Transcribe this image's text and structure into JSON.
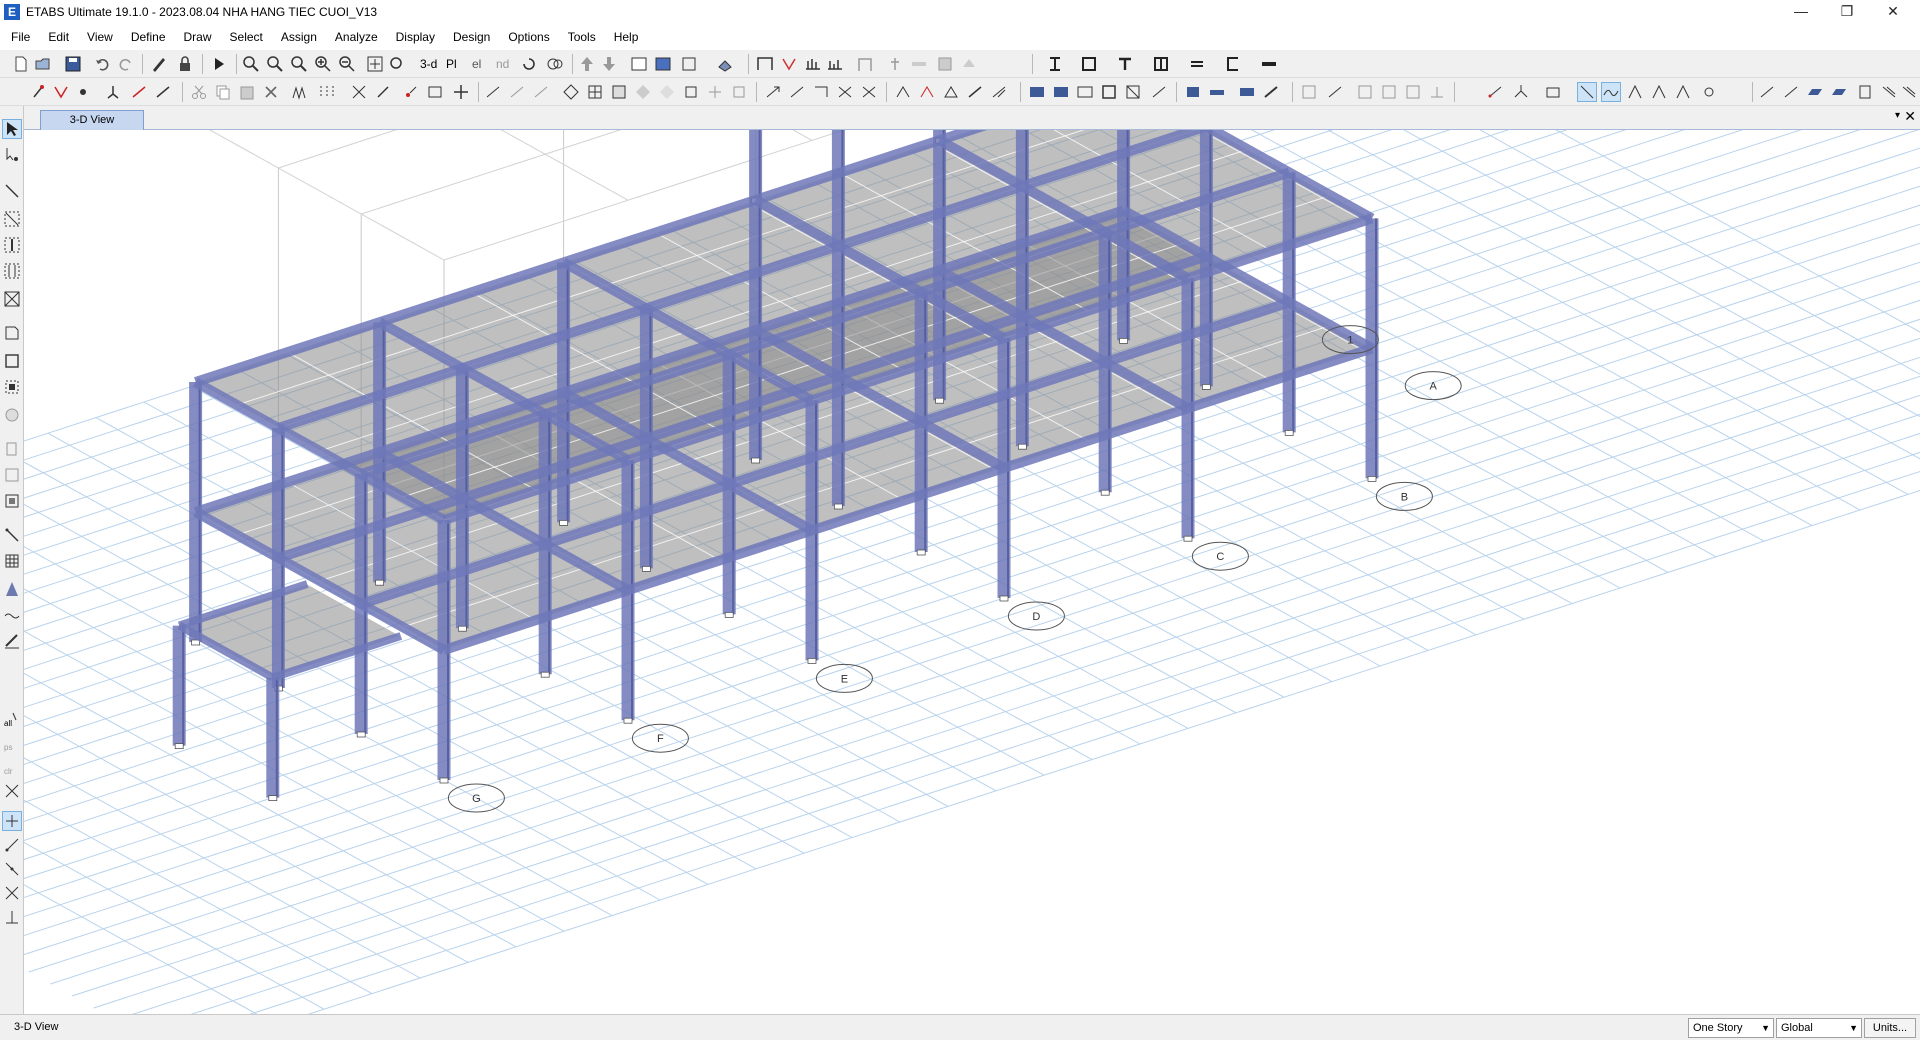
{
  "window": {
    "title": "ETABS Ultimate 19.1.0 - 2023.08.04 NHA HANG TIEC CUOI_V13",
    "app_icon_letter": "E",
    "minimize": "—",
    "restore": "❐",
    "close": "✕"
  },
  "menu": [
    "File",
    "Edit",
    "View",
    "Define",
    "Draw",
    "Select",
    "Assign",
    "Analyze",
    "Display",
    "Design",
    "Options",
    "Tools",
    "Help"
  ],
  "toolbar": {
    "view_3d_label": "3-d",
    "plan_label": "Pl",
    "elev_label": "el",
    "nd_label": "nd"
  },
  "tabs": {
    "active": "3-D View",
    "dropdown_glyph": "▾",
    "close_glyph": "✕"
  },
  "model_view": {
    "grid_bubbles": [
      "G",
      "F",
      "E",
      "D",
      "C",
      "B",
      "A",
      "1"
    ],
    "colors": {
      "frame": "#6f78b8",
      "frame_dark": "#4e5897",
      "slab": "#8a8a8a",
      "grid": "#b9d3ec",
      "background": "#ffffff"
    }
  },
  "statusbar": {
    "view_name": "3-D View",
    "story_combo": "One Story",
    "coord_combo": "Global",
    "units_button": "Units..."
  },
  "icons": {
    "left_toolbar": [
      "pointer-icon",
      "reshape-icon",
      "draw-frame-icon",
      "draw-beam-icon",
      "draw-column-icon",
      "draw-brace-icon",
      "draw-wall-icon",
      "draw-floor-icon",
      "draw-opening-icon",
      "draw-link-icon",
      "draw-grid-icon",
      "draw-section-cut-icon",
      "draw-dimension-icon",
      "select-all-icon",
      "previous-select-icon",
      "clear-select-icon",
      "snap-point-icon",
      "snap-end-icon",
      "snap-middle-icon",
      "snap-intersection-icon",
      "snap-perpendicular-icon"
    ]
  }
}
